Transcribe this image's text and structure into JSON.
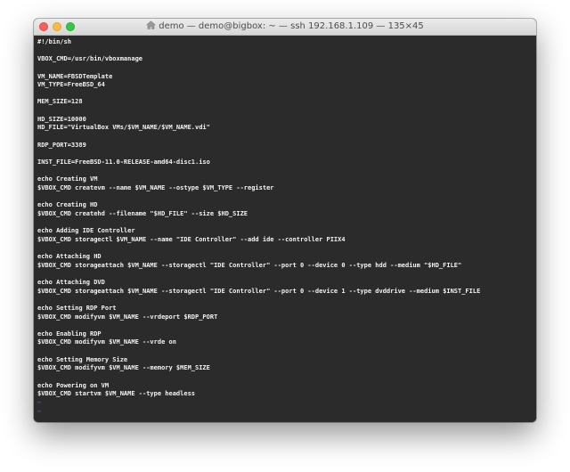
{
  "window": {
    "title": "demo — demo@bigbox: ~ — ssh 192.168.1.109 — 135×45",
    "title_icon": "home-icon",
    "traffic_lights": {
      "close": "#fc605c",
      "minimize": "#fdbc40",
      "zoom": "#34c84a"
    }
  },
  "terminal": {
    "background": "#2b2b2b",
    "foreground": "#f2f2f2",
    "tilde_color": "#5a5ae0",
    "lines": [
      "#!/bin/sh",
      "",
      "VBOX_CMD=/usr/bin/vboxmanage",
      "",
      "VM_NAME=FBSDTemplate",
      "VM_TYPE=FreeBSD_64",
      "",
      "MEM_SIZE=128",
      "",
      "HD_SIZE=10000",
      "HD_FILE=\"VirtualBox VMs/$VM_NAME/$VM_NAME.vdi\"",
      "",
      "RDP_PORT=3389",
      "",
      "INST_FILE=FreeBSD-11.0-RELEASE-amd64-disc1.iso",
      "",
      "echo Creating VM",
      "$VBOX_CMD createvm --name $VM_NAME --ostype $VM_TYPE --register",
      "",
      "echo Creating HD",
      "$VBOX_CMD createhd --filename \"$HD_FILE\" --size $HD_SIZE",
      "",
      "echo Adding IDE Controller",
      "$VBOX_CMD storagectl $VM_NAME --name \"IDE Controller\" --add ide --controller PIIX4",
      "",
      "echo Attaching HD",
      "$VBOX_CMD storageattach $VM_NAME --storagectl \"IDE Controller\" --port 0 --device 0 --type hdd --medium \"$HD_FILE\"",
      "",
      "echo Attaching DVD",
      "$VBOX_CMD storageattach $VM_NAME --storagectl \"IDE Controller\" --port 0 --device 1 --type dvddrive --medium $INST_FILE",
      "",
      "echo Setting RDP Port",
      "$VBOX_CMD modifyvm $VM_NAME --vrdeport $RDP_PORT",
      "",
      "echo Enabling RDP",
      "$VBOX_CMD modifyvm $VM_NAME --vrde on",
      "",
      "echo Setting Memory Size",
      "$VBOX_CMD modifyvm $VM_NAME --memory $MEM_SIZE",
      "",
      "echo Powering on VM",
      "$VBOX_CMD startvm $VM_NAME --type headless"
    ],
    "tilde_lines": [
      "~",
      "~"
    ]
  }
}
